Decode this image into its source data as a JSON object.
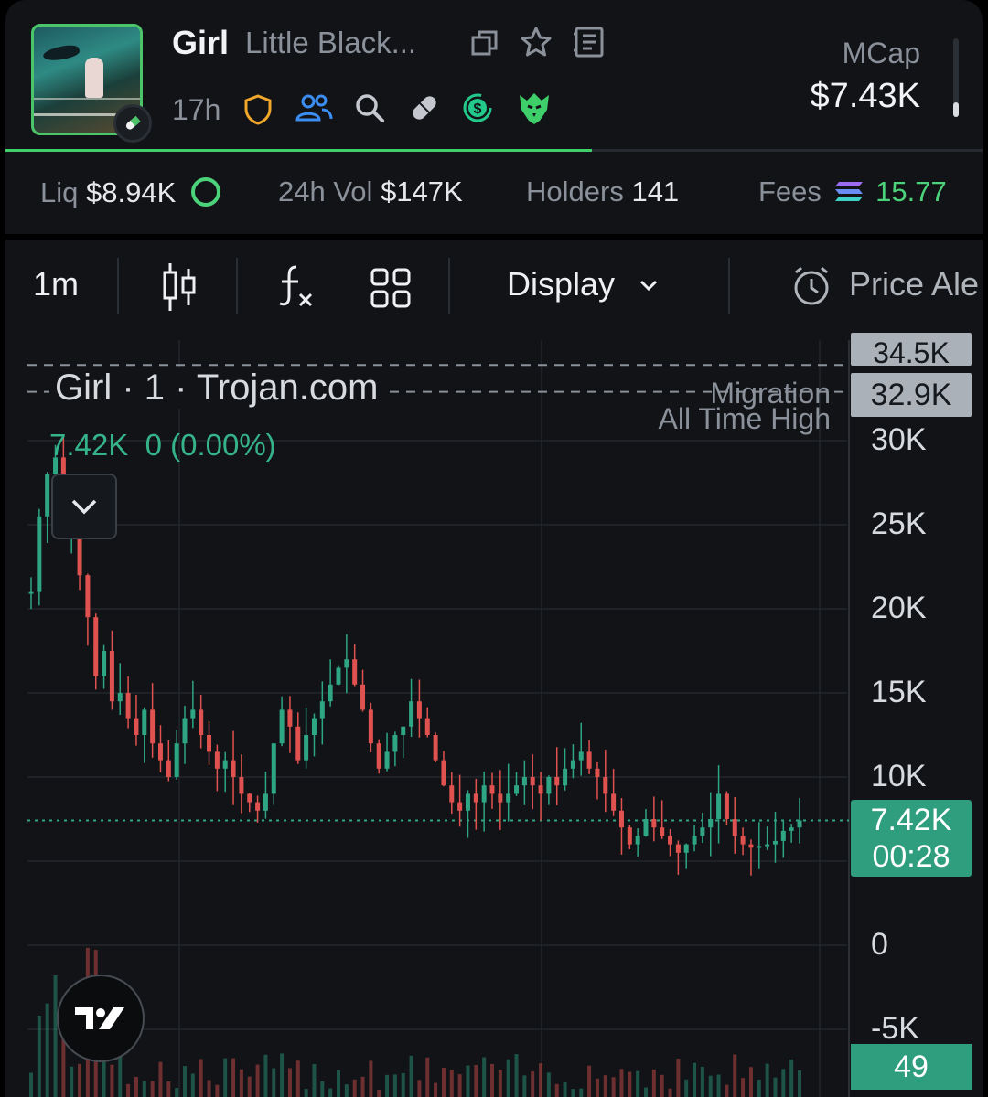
{
  "token": {
    "symbol": "Girl",
    "name": "Little Black...",
    "age": "17h",
    "mcap_label": "MCap",
    "mcap_value": "$7.43K",
    "bonding_progress": 0.6
  },
  "header_icons": [
    "copy-icon",
    "star-icon",
    "notes-icon",
    "shield-icon",
    "holders-icon",
    "search-icon",
    "pill-icon",
    "dollar-refresh-icon",
    "eagle-icon"
  ],
  "stats": {
    "liq_label": "Liq",
    "liq_value": "$8.94K",
    "vol_label": "24h Vol",
    "vol_value": "$147K",
    "holders_label": "Holders",
    "holders_value": "141",
    "fees_label": "Fees",
    "fees_value": "15.77"
  },
  "toolbar": {
    "interval": "1m",
    "display": "Display",
    "price_alert": "Price Ale"
  },
  "chart": {
    "legend_title": "Girl · 1 · Trojan.com",
    "legend_price": "7.42K",
    "legend_change": "0 (0.00%)",
    "migration_label": "Migration",
    "ath_label": "All Time High",
    "top_label": "34.5K",
    "ath_value": "32.9K",
    "y_ticks": [
      "30K",
      "25K",
      "20K",
      "15K",
      "10K",
      "0",
      "-5K"
    ],
    "current_price": "7.42K",
    "countdown": "00:28",
    "volume_label": "49",
    "colors": {
      "up": "#2ea583",
      "down": "#e0524f",
      "accent": "#2e9e7e"
    }
  },
  "chart_data": {
    "type": "line",
    "ylim": [
      -6000,
      34500
    ],
    "ath": 32900,
    "migration": 34500,
    "current": 7420,
    "series": [
      {
        "values": [
          21000,
          25500,
          28000,
          29000,
          24500,
          26000,
          22000,
          19500,
          16000,
          17500,
          14500,
          15000,
          13500,
          12500,
          14000,
          12000,
          11000,
          10000,
          12000,
          13500,
          14000,
          12500,
          11500,
          10500,
          11000,
          10000,
          9000,
          8500,
          8000,
          9000,
          12000,
          14000,
          13000,
          11000,
          12500,
          13500,
          14500,
          15500,
          16500,
          17000,
          15500,
          14000,
          12000,
          10500,
          11500,
          12500,
          13000,
          14500,
          13500,
          12500,
          11000,
          9500,
          8500,
          8000,
          9000,
          8500,
          9500,
          9000,
          8500,
          9000,
          9500,
          10000,
          9500,
          9000,
          10000,
          9500,
          10500,
          11000,
          11500,
          10500,
          10000,
          9000,
          8000,
          7000,
          6000,
          6500,
          7500,
          7000,
          6500,
          6000,
          5500,
          6000,
          6500,
          7000,
          7500,
          9000,
          7500,
          6500,
          6000,
          5800,
          5900,
          6000,
          6200,
          6800,
          7000,
          7420
        ]
      }
    ]
  }
}
